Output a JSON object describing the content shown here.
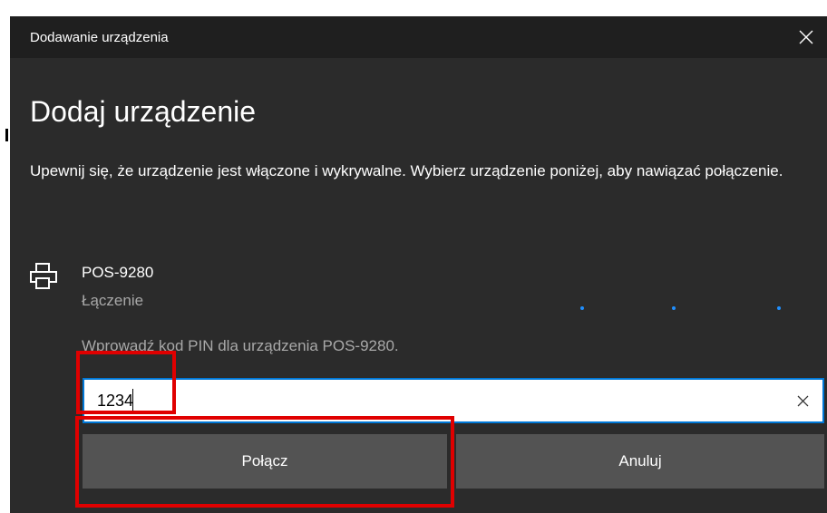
{
  "window": {
    "title": "Dodawanie urządzenia",
    "close_icon": "close-icon"
  },
  "dialog": {
    "heading": "Dodaj urządzenie",
    "description": "Upewnij się, że urządzenie jest włączone i wykrywalne. Wybierz urządzenie poniżej, aby nawiązać połączenie."
  },
  "device": {
    "icon": "printer-icon",
    "name": "POS-9280",
    "status": "Łączenie"
  },
  "pin": {
    "prompt": "Wprowadź kod PIN dla urządzenia POS-9280.",
    "value": "1234",
    "clear_icon": "clear-icon"
  },
  "buttons": {
    "connect_label": "Połącz",
    "cancel_label": "Anuluj"
  },
  "colors": {
    "dialog_bg": "#2b2b2b",
    "titlebar_bg": "#1f1f1f",
    "accent": "#0078d7",
    "button_bg": "#535353",
    "highlight": "#e00000"
  }
}
